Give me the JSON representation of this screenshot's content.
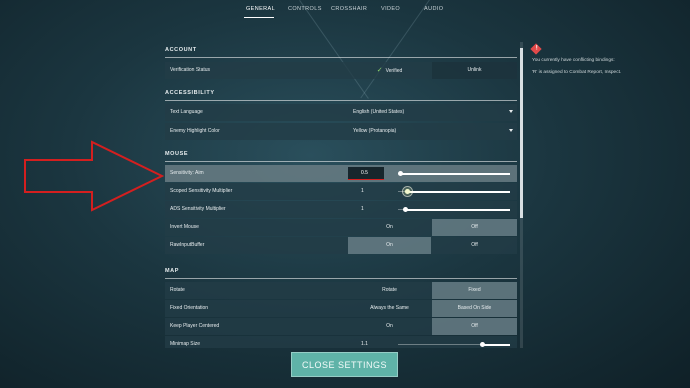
{
  "nav": {
    "tabs": [
      {
        "label": "GENERAL",
        "active": true
      },
      {
        "label": "CONTROLS",
        "active": false
      },
      {
        "label": "CROSSHAIR",
        "active": false
      },
      {
        "label": "VIDEO",
        "active": false
      },
      {
        "label": "AUDIO",
        "active": false
      }
    ]
  },
  "sections": {
    "account": {
      "title": "ACCOUNT",
      "verification": {
        "label": "Verification Status",
        "verified": "Verified",
        "unlink": "Unlink"
      }
    },
    "accessibility": {
      "title": "ACCESSIBILITY",
      "text_language": {
        "label": "Text Language",
        "value": "English (United States)"
      },
      "highlight_color": {
        "label": "Enemy Highlight Color",
        "value": "Yellow (Protanopia)"
      }
    },
    "mouse": {
      "title": "MOUSE",
      "sensitivity_aim": {
        "label": "Sensitivity: Aim",
        "value": "0.5",
        "level": 0.02
      },
      "scoped_multiplier": {
        "label": "Scoped Sensitivity Multiplier",
        "value": "1",
        "level": 0.08
      },
      "ads_multiplier": {
        "label": "ADS Sensitivity Multiplier",
        "value": "1",
        "level": 0.06
      },
      "invert_mouse": {
        "label": "Invert Mouse",
        "on": "On",
        "off": "Off",
        "selected": "Off"
      },
      "raw_input": {
        "label": "RawInputBuffer",
        "on": "On",
        "off": "Off",
        "selected": "On"
      }
    },
    "map": {
      "title": "MAP",
      "rotate": {
        "label": "Rotate",
        "opt1": "Rotate",
        "opt2": "Fixed",
        "selected": "Fixed"
      },
      "fixed_orientation": {
        "label": "Fixed Orientation",
        "opt1": "Always the Same",
        "opt2": "Based On Side",
        "selected": "Based On Side"
      },
      "keep_player_centered": {
        "label": "Keep Player Centered",
        "on": "On",
        "off": "Off",
        "selected": "Off"
      },
      "minimap_size": {
        "label": "Minimap Size",
        "value": "1.1",
        "level": 0.75
      }
    }
  },
  "notice": {
    "line1": "You currently have conflicting bindings:",
    "line2": "'R' is assigned to Combat Report, Inspect."
  },
  "close_label": "CLOSE SETTINGS",
  "colors": {
    "accent": "#5fb3a8",
    "annotation": "#d41f1f",
    "verified": "#8fd66b",
    "warning": "#e24a4a"
  }
}
